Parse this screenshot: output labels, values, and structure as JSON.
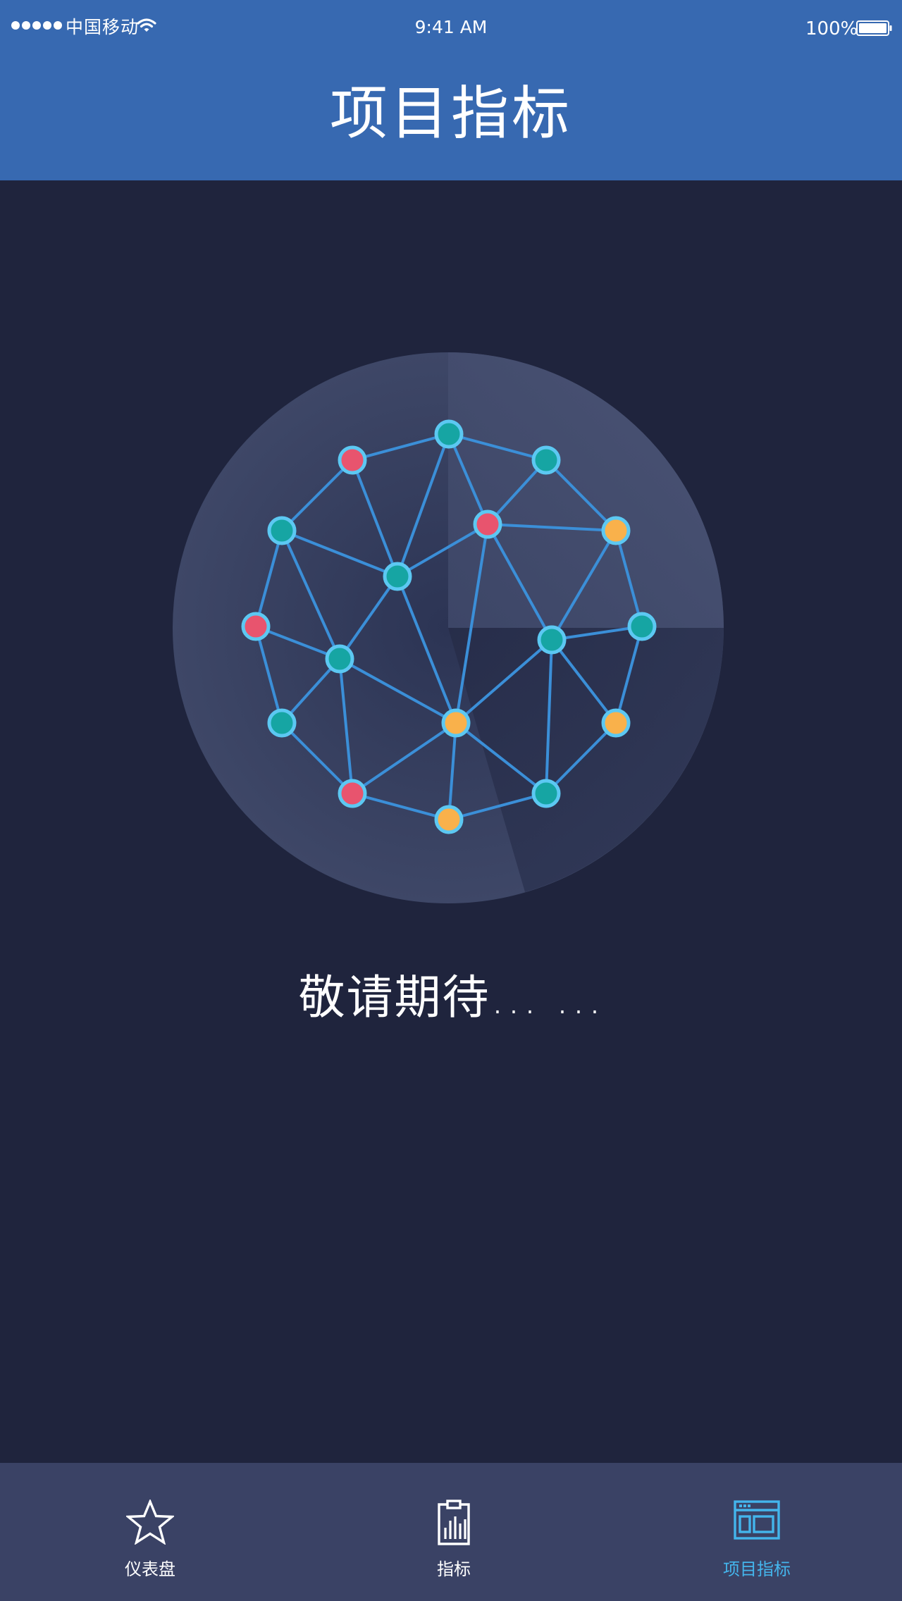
{
  "status_bar": {
    "carrier": "中国移动",
    "time": "9:41 AM",
    "battery": "100%"
  },
  "header": {
    "title": "项目指标"
  },
  "main": {
    "message": "敬请期待... ..."
  },
  "tabs": [
    {
      "label": "仪表盘",
      "icon": "star-icon",
      "active": false
    },
    {
      "label": "指标",
      "icon": "clipboard-chart-icon",
      "active": false
    },
    {
      "label": "项目指标",
      "icon": "dashboard-layout-icon",
      "active": true
    }
  ],
  "colors": {
    "header_blue": "#3769b1",
    "background": "#1f243d",
    "tab_bar": "#3a4265",
    "accent": "#44b5ec",
    "node_teal": "#16a5a3",
    "node_red": "#e8546e",
    "node_orange": "#f9b14b",
    "edge_blue": "#3b8fd8"
  }
}
